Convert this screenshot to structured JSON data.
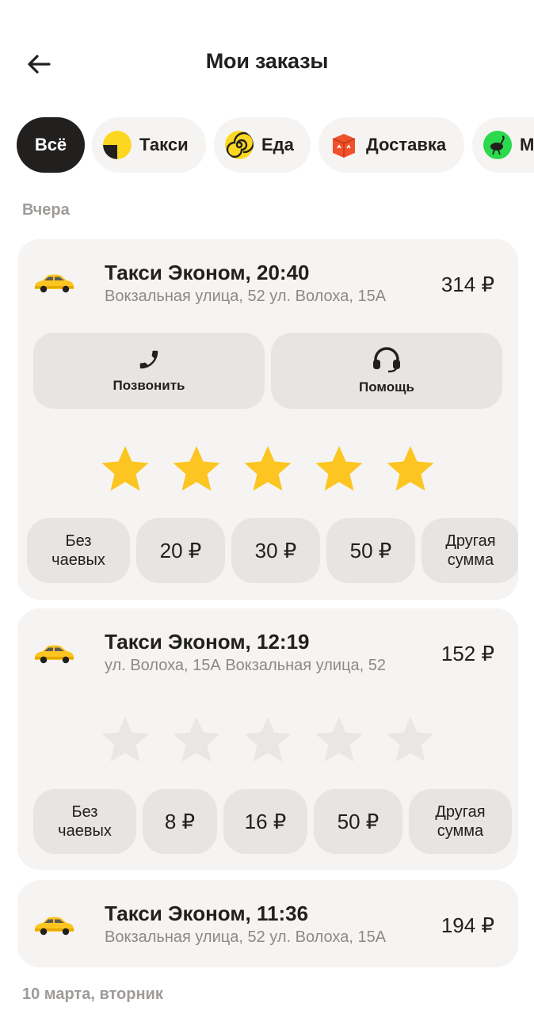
{
  "header": {
    "title": "Мои заказы"
  },
  "filters": [
    {
      "label": "Всё",
      "icon": "all"
    },
    {
      "label": "Такси",
      "icon": "taxi-logo-icon"
    },
    {
      "label": "Еда",
      "icon": "food-logo-icon"
    },
    {
      "label": "Доставка",
      "icon": "delivery-logo-icon"
    },
    {
      "label": "М",
      "icon": "market-logo-icon"
    }
  ],
  "sections": {
    "yesterday": "Вчера",
    "march10": "10 марта, вторник"
  },
  "orders": [
    {
      "title": "Такси Эконом, 20:40",
      "route": "Вокзальная улица, 52 ул. Волоха, 15А",
      "price": "314 ₽",
      "actions": {
        "call": "Позвонить",
        "help": "Помощь"
      },
      "rating": 5,
      "tips": [
        "Без\nчаевых",
        "20 ₽",
        "30 ₽",
        "50 ₽",
        "Другая\nсумма"
      ]
    },
    {
      "title": "Такси Эконом, 12:19",
      "route": "ул. Волоха, 15А Вокзальная улица, 52",
      "price": "152 ₽",
      "rating": 0,
      "tips": [
        "Без\nчаевых",
        "8 ₽",
        "16 ₽",
        "50 ₽",
        "Другая\nсумма"
      ]
    },
    {
      "title": "Такси Эконом, 11:36",
      "route": "Вокзальная улица, 52 ул. Волоха, 15А",
      "price": "194 ₽"
    }
  ],
  "colors": {
    "star_active": "#fcc521",
    "star_inactive": "#e8e7e5",
    "accent_yellow": "#fcd720",
    "dark": "#21201f"
  }
}
